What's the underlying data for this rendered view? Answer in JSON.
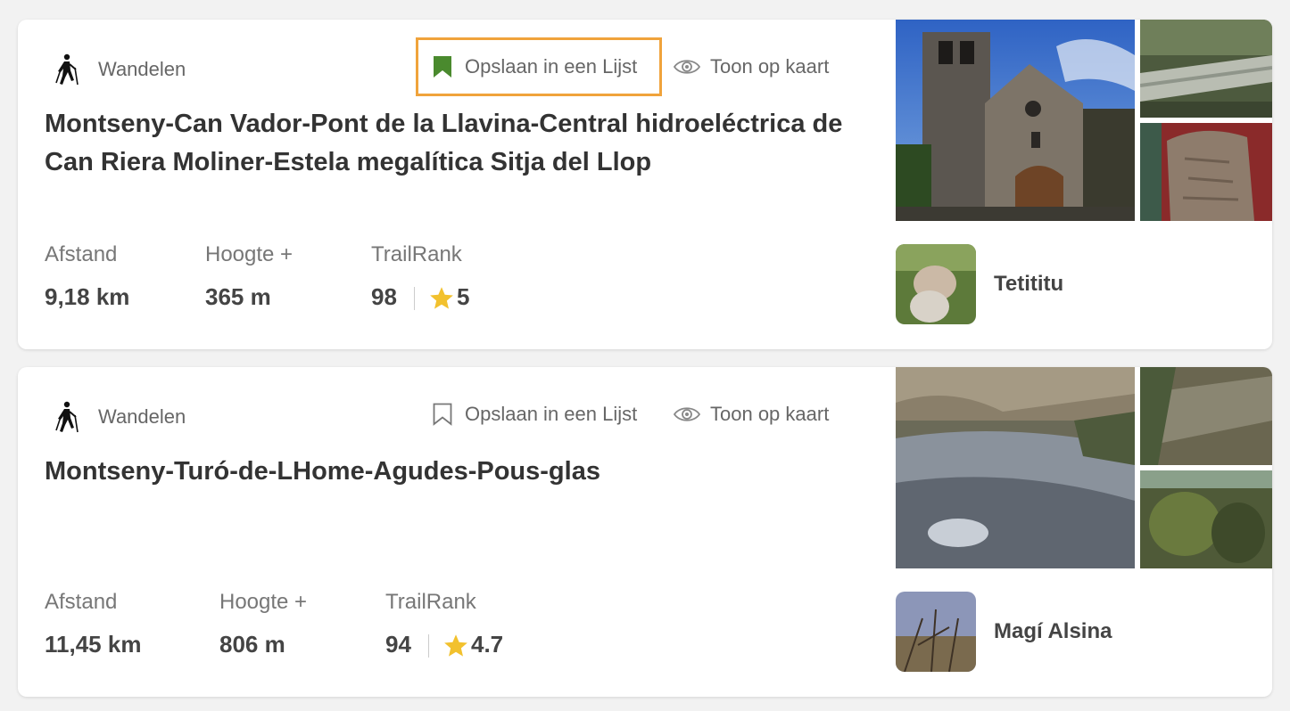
{
  "trails": [
    {
      "activity": "Wandelen",
      "save_label": "Opslaan in een Lijst",
      "map_label": "Toon op kaart",
      "title": "Montseny-Can Vador-Pont de la Llavina-Central hidroeléctrica de Can Riera Moliner-Estela megalítica Sitja del Llop",
      "stats": {
        "distance_label": "Afstand",
        "distance_value": "9,18 km",
        "elevation_label": "Hoogte +",
        "elevation_value": "365 m",
        "trailrank_label": "TrailRank",
        "trailrank_value": "98",
        "rating": "5"
      },
      "author": "Tetititu",
      "saved": true
    },
    {
      "activity": "Wandelen",
      "save_label": "Opslaan in een Lijst",
      "map_label": "Toon op kaart",
      "title": "Montseny-Turó-de-LHome-Agudes-Pous-glas",
      "stats": {
        "distance_label": "Afstand",
        "distance_value": "11,45 km",
        "elevation_label": "Hoogte +",
        "elevation_value": "806 m",
        "trailrank_label": "TrailRank",
        "trailrank_value": "94",
        "rating": "4.7"
      },
      "author": "Magí Alsina",
      "saved": false
    }
  ],
  "icons": {
    "activity": "hiker-icon",
    "save_saved": "bookmark-filled-icon",
    "save_unsaved": "bookmark-outline-icon",
    "map": "eye-icon",
    "rating": "star-icon"
  },
  "colors": {
    "save_highlight": "#f0a33b",
    "bookmark_saved": "#4a8a2e",
    "star": "#f2c12e"
  }
}
